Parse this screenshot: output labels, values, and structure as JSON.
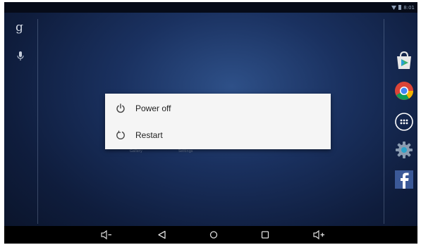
{
  "status_bar": {
    "time": "8:01"
  },
  "home_screen": {
    "search_logo": "g",
    "ghost_labels": [
      "Gallery",
      "Settings"
    ]
  },
  "power_dialog": {
    "items": [
      {
        "label": "Power off",
        "icon": "power-icon"
      },
      {
        "label": "Restart",
        "icon": "restart-icon"
      }
    ]
  },
  "dock": [
    "play-store-icon",
    "chrome-icon",
    "app-drawer-icon",
    "settings-icon",
    "facebook-icon"
  ],
  "nav_bar": [
    "volume-down-icon",
    "back-icon",
    "home-icon",
    "recents-icon",
    "volume-up-icon"
  ],
  "colors": {
    "dialog_bg": "#f5f5f5",
    "wallpaper": "#1a3160",
    "nav_bar": "#000000"
  }
}
